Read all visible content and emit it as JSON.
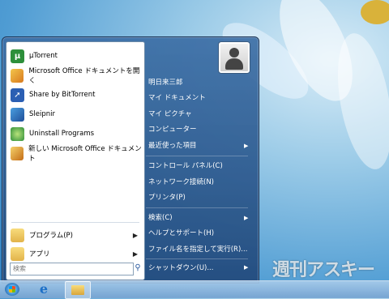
{
  "left_pane": {
    "items": [
      {
        "label": "µTorrent",
        "icon": "utorrent-icon"
      },
      {
        "label": "Microsoft Office ドキュメントを開く",
        "icon": "office-open-icon"
      },
      {
        "label": "Share by BitTorrent",
        "icon": "share-icon"
      },
      {
        "label": "Sleipnir",
        "icon": "sleipnir-icon"
      },
      {
        "label": "Uninstall Programs",
        "icon": "uninstall-icon"
      },
      {
        "label": "新しい Microsoft Office ドキュメント",
        "icon": "office-new-icon"
      }
    ],
    "programs_label": "プログラム(P)",
    "apps_label": "アプリ",
    "search_placeholder": "検索"
  },
  "right_pane": {
    "items": [
      "明日来三郎",
      "マイ ドキュメント",
      "マイ ピクチャ",
      "コンピューター",
      "最近使った項目",
      "コントロール パネル(C)",
      "ネットワーク接続(N)",
      "プリンタ(P)",
      "検索(C)",
      "ヘルプとサポート(H)",
      "ファイル名を指定して実行(R)...",
      "シャットダウン(U)..."
    ]
  },
  "watermark": "週刊アスキー",
  "colors": {
    "menu_blue": "#3b6ea5",
    "left_bg": "#ffffff"
  }
}
